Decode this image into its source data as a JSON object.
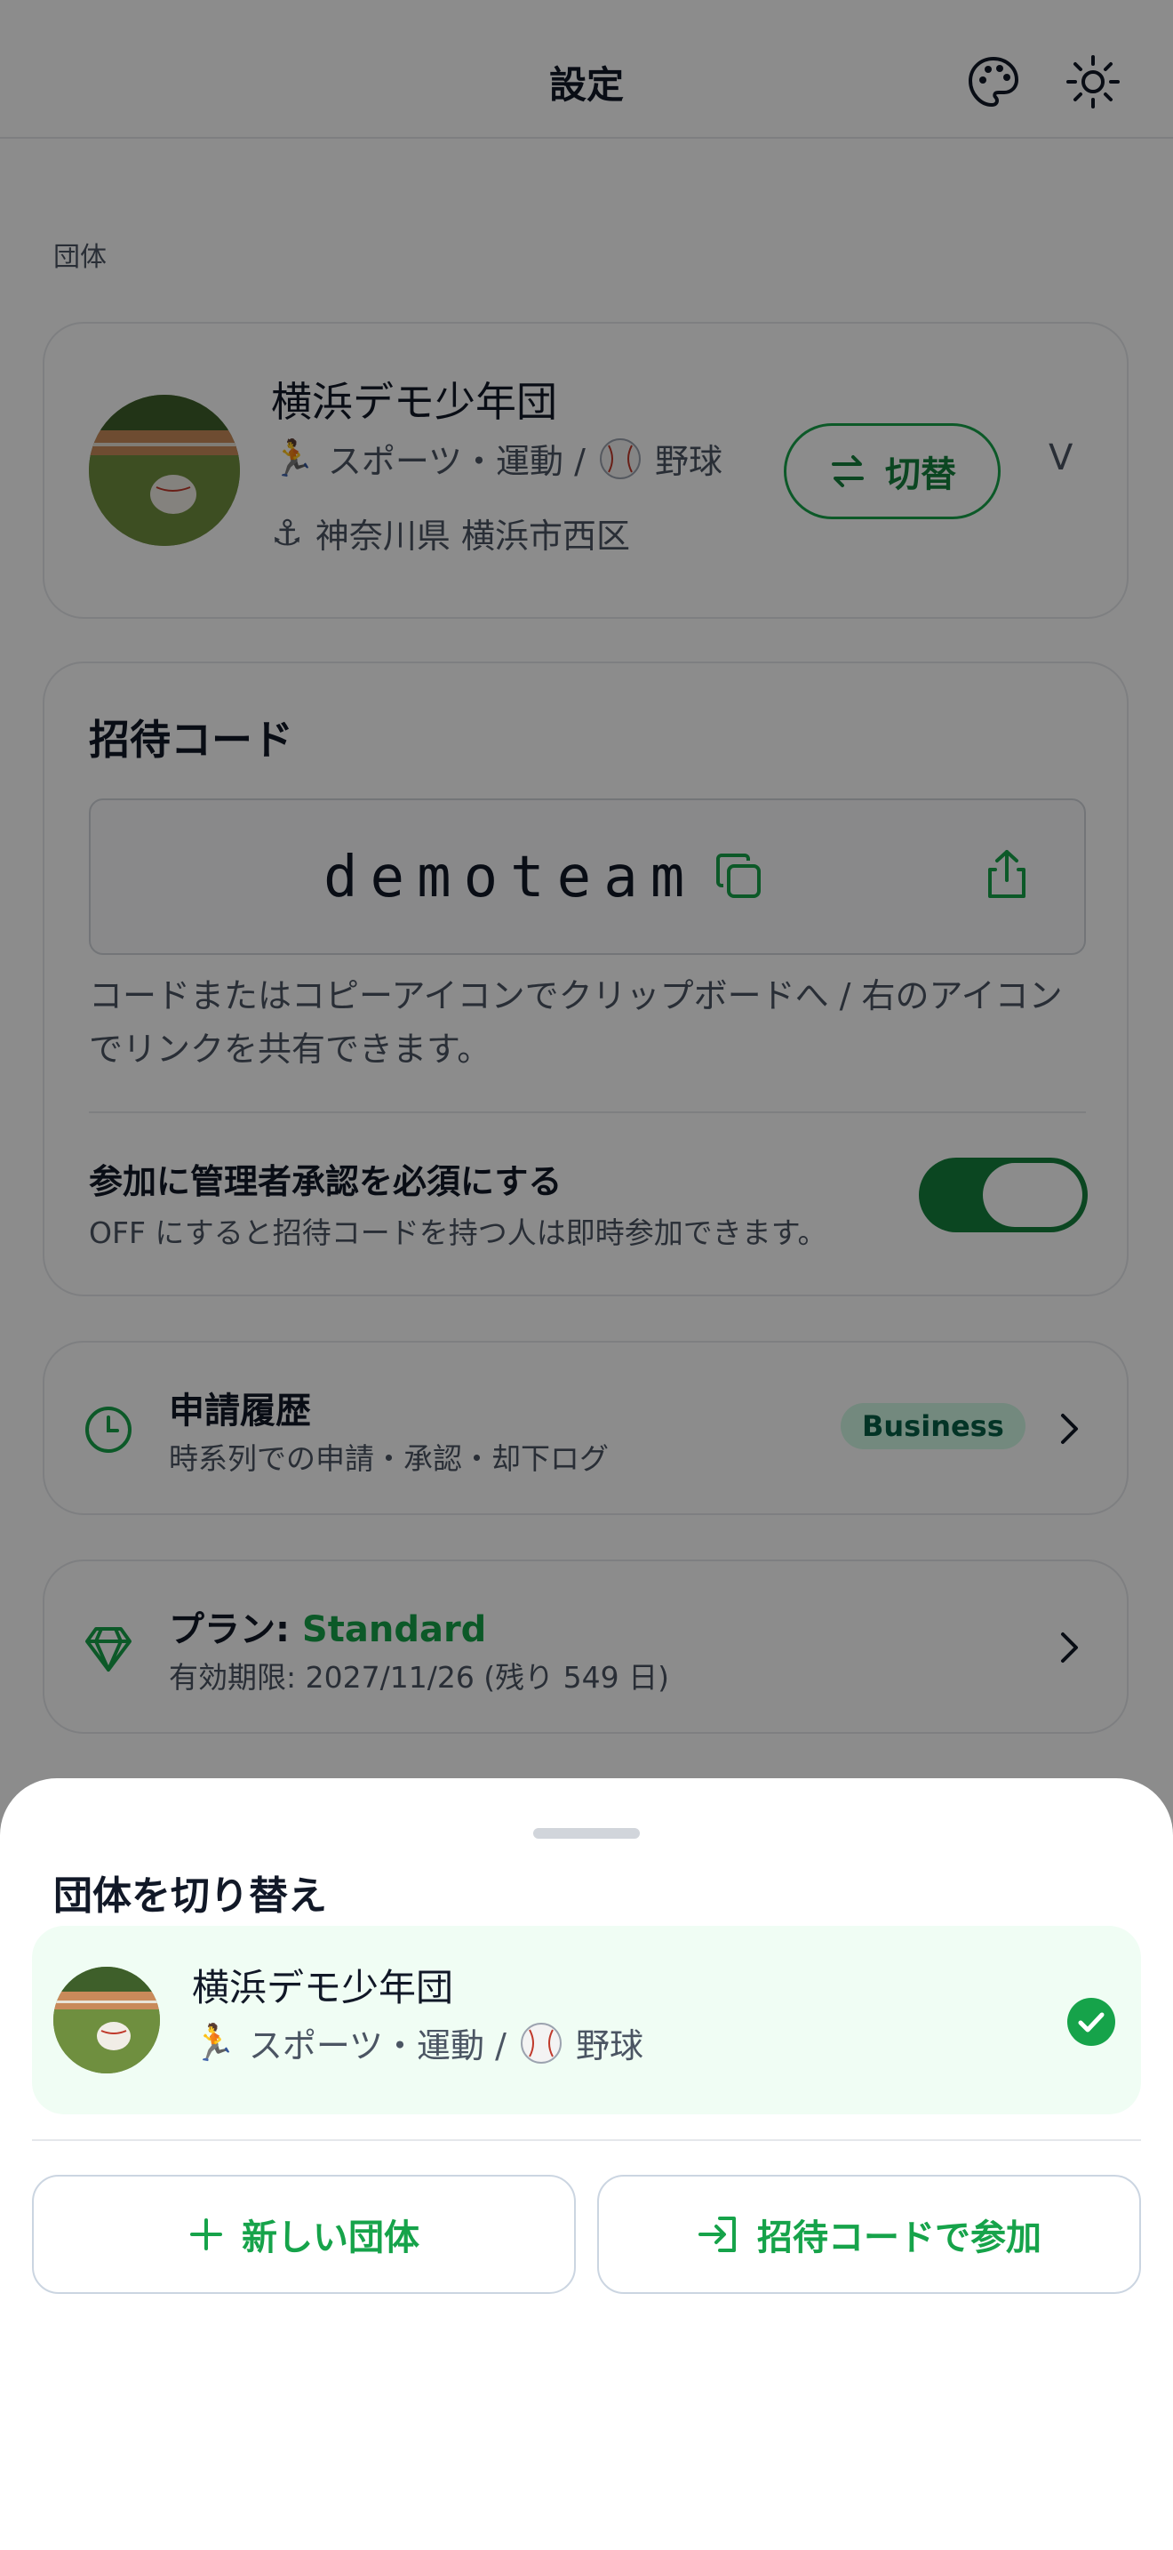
{
  "header": {
    "title": "設定",
    "palette_icon": "palette-icon",
    "theme_icon": "sun-icon"
  },
  "section_label": "団体",
  "team": {
    "name": "横浜デモ少年団",
    "sport_emoji": "🏃",
    "sport": "スポーツ・運動 /",
    "sub_sport": "野球",
    "location_emoji": "⚓",
    "location": "神奈川県 横浜市西区",
    "switch_label": "切替",
    "chevron": "V"
  },
  "invite": {
    "title": "招待コード",
    "code": "demoteam",
    "help": "コードまたはコピーアイコンでクリップボードへ / 右のアイコンでリンクを共有できます。",
    "approval_title": "参加に管理者承認を必須にする",
    "approval_sub": "OFF にすると招待コードを持つ人は即時参加できます。",
    "approval_on": true
  },
  "history": {
    "title": "申請履歴",
    "sub": "時系列での申請・承認・却下ログ",
    "badge": "Business"
  },
  "plan": {
    "label": "プラン: ",
    "value": "Standard",
    "expiry": "有効期限: 2027/11/26 (残り 549 日)"
  },
  "sheet": {
    "title": "団体を切り替え",
    "option": {
      "name": "横浜デモ少年団",
      "sport_emoji": "🏃",
      "sport": "スポーツ・運動 /",
      "sub_sport": "野球",
      "selected": true
    },
    "new_team_label": "新しい団体",
    "join_label": "招待コードで参加"
  },
  "colors": {
    "accent": "#16a34a",
    "accent_dark": "#15803d",
    "badge_bg": "#d1fae5",
    "selected_bg": "#f0fdf4",
    "overlay": "rgba(0,0,0,0.45)"
  }
}
